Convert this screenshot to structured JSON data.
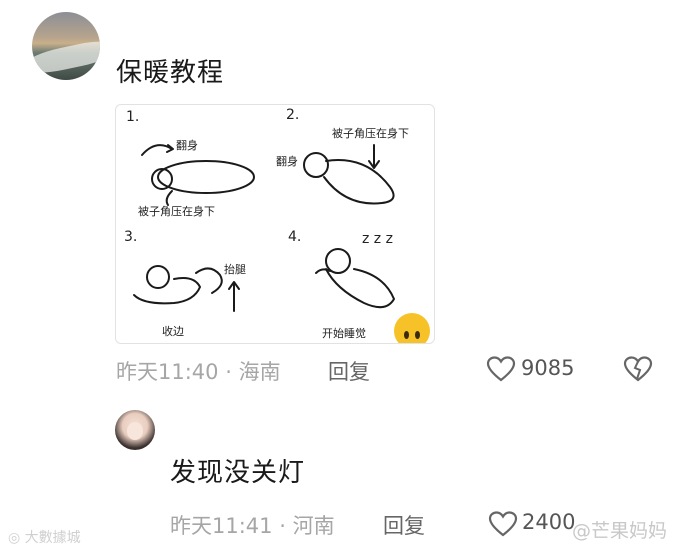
{
  "comments": [
    {
      "text": "保暖教程",
      "time": "昨天11:40",
      "location": "海南",
      "reply_label": "回复",
      "likes": "9085"
    },
    {
      "text": "发现没关灯",
      "time": "昨天11:41",
      "location": "河南",
      "reply_label": "回复",
      "likes": "2400"
    }
  ],
  "separator": "·",
  "tutorial": {
    "steps": [
      {
        "number": "1.",
        "labels": [
          "翻身",
          "被子角压在身下"
        ]
      },
      {
        "number": "2.",
        "labels": [
          "被子角压在身下",
          "翻身"
        ]
      },
      {
        "number": "3.",
        "labels": [
          "抬腿",
          "收边"
        ]
      },
      {
        "number": "4.",
        "labels": [
          "开始睡觉"
        ],
        "zzz": "z z z"
      }
    ]
  },
  "icons": {
    "like": "heart-outline-icon",
    "dislike": "broken-heart-icon",
    "emoji": "grimace-emoji-icon"
  },
  "watermarks": {
    "left": "大數據城",
    "right": "@芒果妈妈"
  }
}
